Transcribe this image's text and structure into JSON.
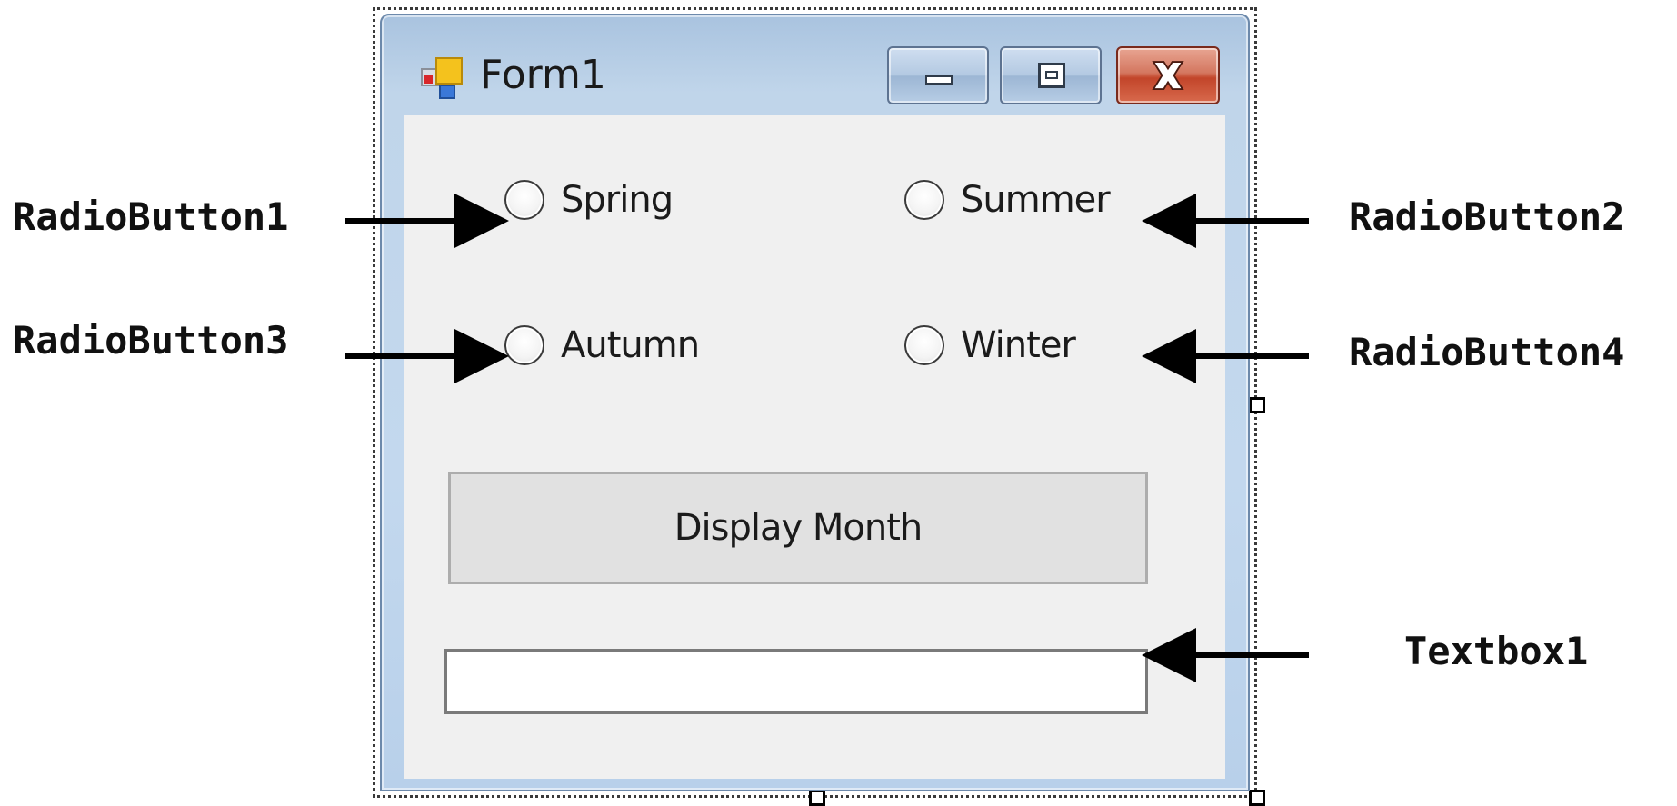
{
  "window": {
    "title": "Form1",
    "icon": "winforms-form-icon",
    "controls": [
      "minimize-icon",
      "maximize-icon",
      "close-icon"
    ]
  },
  "form": {
    "radio_buttons": [
      {
        "label": "Spring",
        "checked": false
      },
      {
        "label": "Summer",
        "checked": false
      },
      {
        "label": "Autumn",
        "checked": false
      },
      {
        "label": "Winter",
        "checked": false
      }
    ],
    "button_label": "Display Month",
    "textbox_value": ""
  },
  "annotations": {
    "radiobutton1": "RadioButton1",
    "radiobutton2": "RadioButton2",
    "radiobutton3": "RadioButton3",
    "radiobutton4": "RadioButton4",
    "textbox1": "Textbox1"
  },
  "colors": {
    "close_button": "#c9492d",
    "client_background": "#f0f0f0",
    "frame": "#c0d5ea",
    "button_face": "#e1e1e1"
  }
}
